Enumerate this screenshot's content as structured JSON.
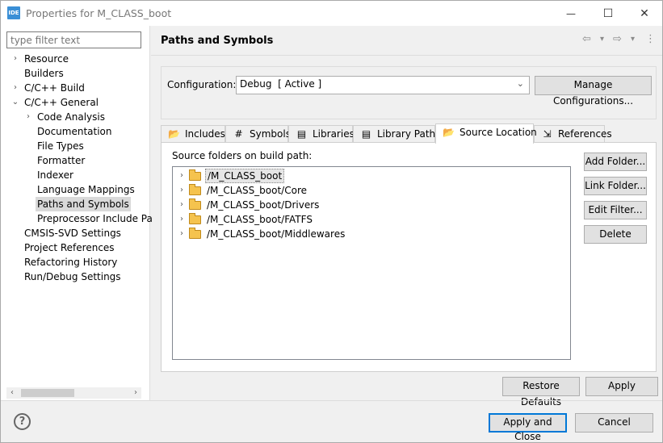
{
  "window": {
    "icon_text": "IDE",
    "title": "Properties for M_CLASS_boot",
    "min_glyph": "—",
    "max_glyph": "☐",
    "close_glyph": "✕"
  },
  "filter": {
    "placeholder": "type filter text"
  },
  "tree": [
    {
      "label": "Resource",
      "arrow": "›"
    },
    {
      "label": "Builders",
      "arrow": ""
    },
    {
      "label": "C/C++ Build",
      "arrow": "›"
    },
    {
      "label": "C/C++ General",
      "arrow": "⌄"
    },
    {
      "label": "Code Analysis",
      "arrow": "›"
    },
    {
      "label": "Documentation",
      "arrow": ""
    },
    {
      "label": "File Types",
      "arrow": ""
    },
    {
      "label": "Formatter",
      "arrow": ""
    },
    {
      "label": "Indexer",
      "arrow": ""
    },
    {
      "label": "Language Mappings",
      "arrow": ""
    },
    {
      "label": "Paths and Symbols",
      "arrow": ""
    },
    {
      "label": "Preprocessor Include Pa",
      "arrow": ""
    },
    {
      "label": "CMSIS-SVD Settings",
      "arrow": ""
    },
    {
      "label": "Project References",
      "arrow": ""
    },
    {
      "label": "Refactoring History",
      "arrow": ""
    },
    {
      "label": "Run/Debug Settings",
      "arrow": ""
    }
  ],
  "scroll": {
    "left": "‹",
    "right": "›"
  },
  "page": {
    "title": "Paths and Symbols",
    "nav_back": "⇦",
    "nav_back_menu": "▾",
    "nav_forward": "⇨",
    "nav_forward_menu": "▾",
    "more": "⋮"
  },
  "config": {
    "label": "Configuration:",
    "value": "Debug  [ Active ]",
    "chevron": "⌄",
    "manage_label": "Manage Configurations..."
  },
  "tabs": [
    {
      "label": "Includes",
      "icon": "📂"
    },
    {
      "label": "Symbols",
      "icon": "#"
    },
    {
      "label": "Libraries",
      "icon": "▤"
    },
    {
      "label": "Library Paths",
      "icon": "▤"
    },
    {
      "label": "Source Location",
      "icon": "📂"
    },
    {
      "label": "References",
      "icon": "⇲"
    }
  ],
  "source": {
    "label": "Source folders on build path:",
    "arrow": "›",
    "folders": [
      "/M_CLASS_boot",
      "/M_CLASS_boot/Core",
      "/M_CLASS_boot/Drivers",
      "/M_CLASS_boot/FATFS",
      "/M_CLASS_boot/Middlewares"
    ],
    "buttons": {
      "add_folder": "Add Folder...",
      "link_folder": "Link Folder...",
      "edit_filter": "Edit Filter...",
      "delete": "Delete"
    }
  },
  "footer": {
    "restore_defaults": "Restore Defaults",
    "apply": "Apply",
    "apply_close": "Apply and Close",
    "cancel": "Cancel",
    "help": "?"
  }
}
